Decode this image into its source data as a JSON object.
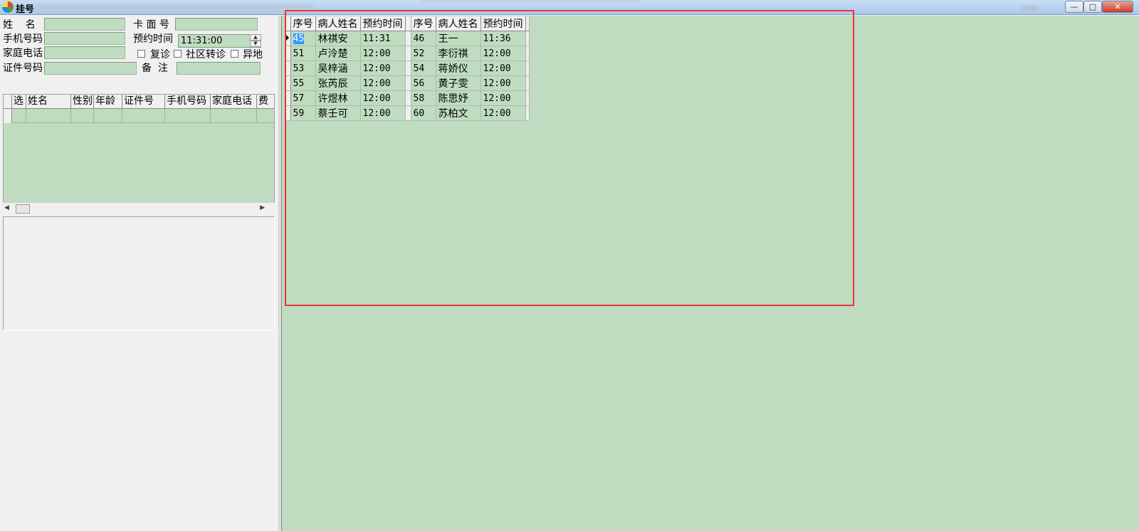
{
  "window": {
    "title": "挂号",
    "controls": {
      "minimize": "—",
      "maximize": "□",
      "close": "✕"
    }
  },
  "form": {
    "name_label": "姓    名",
    "card_label": "卡 面 号",
    "phone_label": "手机号码",
    "appt_time_label": "预约时间",
    "appt_time_value": "11:31:00",
    "home_phone_label": "家庭电话",
    "revisit_label": "复诊",
    "community_label": "社区转诊",
    "remote_label": "异地",
    "id_label": "证件号码",
    "remark_label": "备  注"
  },
  "patient_grid": {
    "columns": [
      "选",
      "姓名",
      "性别",
      "年龄",
      "证件号",
      "手机号码",
      "家庭电话",
      "费"
    ]
  },
  "appointments": {
    "headers": [
      "序号",
      "病人姓名",
      "预约时间",
      "序号",
      "病人姓名",
      "预约时间"
    ],
    "rows": [
      {
        "no1": "45",
        "name1": "林祺安",
        "time1": "11:31",
        "no2": "46",
        "name2": "王一",
        "time2": "11:36"
      },
      {
        "no1": "51",
        "name1": "卢泠楚",
        "time1": "12:00",
        "no2": "52",
        "name2": "李衍祺",
        "time2": "12:00"
      },
      {
        "no1": "53",
        "name1": "吴梓涵",
        "time1": "12:00",
        "no2": "54",
        "name2": "蒋娇仪",
        "time2": "12:00"
      },
      {
        "no1": "55",
        "name1": "张芮辰",
        "time1": "12:00",
        "no2": "56",
        "name2": "黄子雯",
        "time2": "12:00"
      },
      {
        "no1": "57",
        "name1": "许煜林",
        "time1": "12:00",
        "no2": "58",
        "name2": "陈思妤",
        "time2": "12:00"
      },
      {
        "no1": "59",
        "name1": "蔡壬可",
        "time1": "12:00",
        "no2": "60",
        "name2": "苏柏文",
        "time2": "12:00"
      }
    ]
  },
  "colors": {
    "grid_background": "#c0dcc0",
    "highlight_border": "#ee3333",
    "selection": "#3399ff"
  }
}
